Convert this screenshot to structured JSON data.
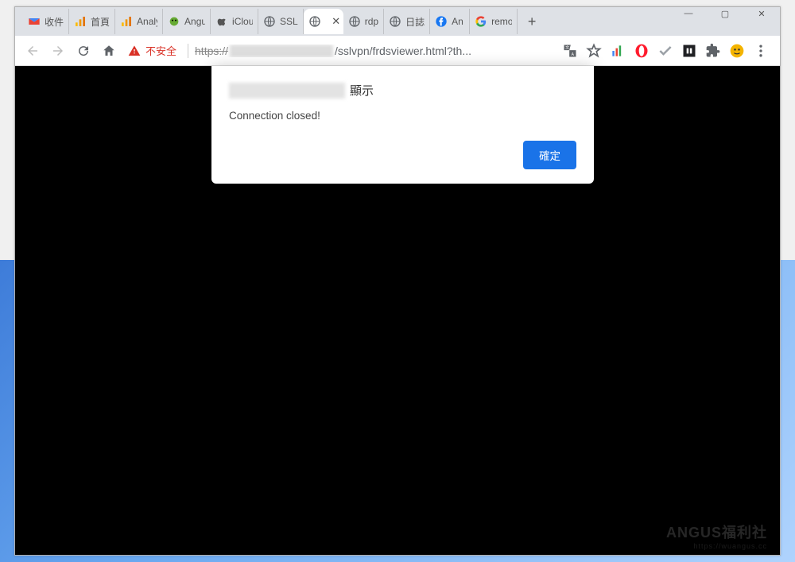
{
  "window": {
    "controls": {
      "min": "—",
      "max": "▢",
      "close": "✕"
    }
  },
  "tabs": [
    {
      "label": "收件",
      "icon": "gmail"
    },
    {
      "label": "首頁",
      "icon": "ga-orange"
    },
    {
      "label": "Analytics",
      "icon": "ga-orange"
    },
    {
      "label": "Angus",
      "icon": "bug"
    },
    {
      "label": "iCloud",
      "icon": "apple"
    },
    {
      "label": "SSL",
      "icon": "globe"
    },
    {
      "label": "",
      "icon": "globe",
      "active": true
    },
    {
      "label": "rdp",
      "icon": "globe"
    },
    {
      "label": "日誌",
      "icon": "globe"
    },
    {
      "label": "An",
      "icon": "facebook"
    },
    {
      "label": "remote",
      "icon": "google"
    }
  ],
  "newtab_label": "+",
  "toolbar": {
    "security_label": "不安全",
    "url_scheme": "https://",
    "url_path": "/sslvpn/frdsviewer.html?th..."
  },
  "dialog": {
    "says": "顯示",
    "message": "Connection closed!",
    "ok": "確定"
  },
  "watermark": {
    "main": "ANGUS福利社",
    "sub": "https://wuangus.cc"
  }
}
